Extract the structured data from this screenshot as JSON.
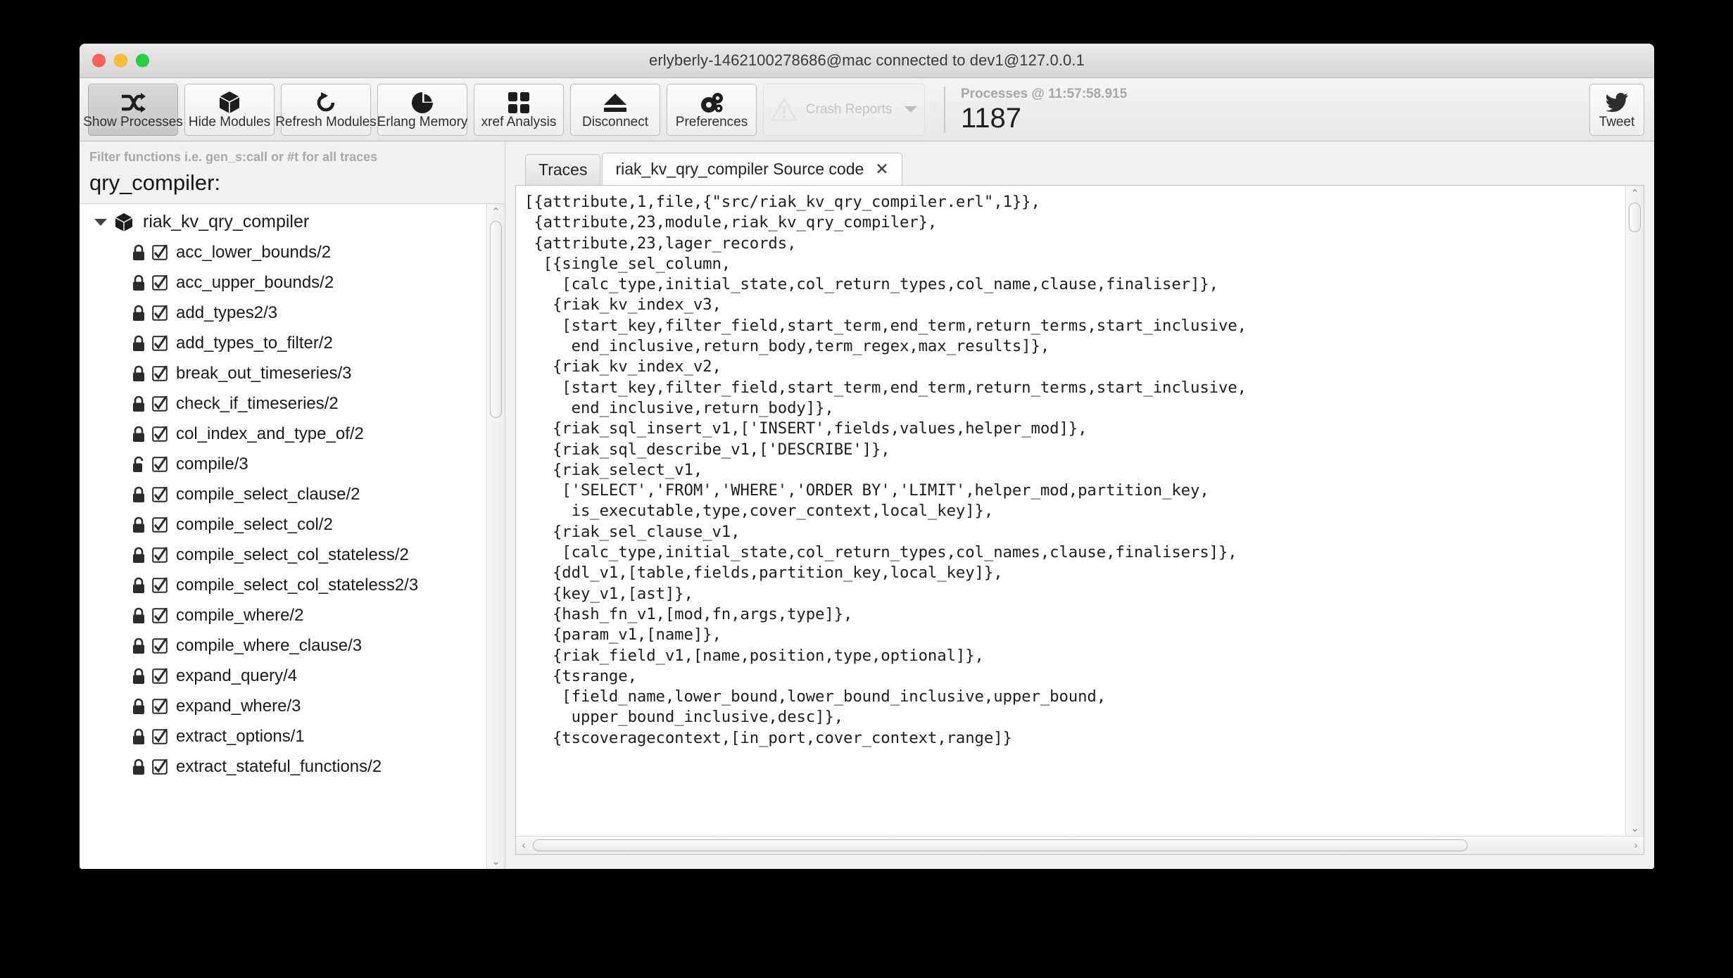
{
  "window": {
    "title": "erlyberly-1462100278686@mac connected to dev1@127.0.0.1",
    "traffic": {
      "close": "close-button",
      "minimize": "minimize-button",
      "zoom": "zoom-button"
    }
  },
  "toolbar": {
    "buttons": [
      {
        "label": "Show Processes",
        "icon": "shuffle-icon",
        "state": "active"
      },
      {
        "label": "Hide Modules",
        "icon": "cube-icon",
        "state": "normal"
      },
      {
        "label": "Refresh Modules",
        "icon": "refresh-icon",
        "state": "normal"
      },
      {
        "label": "Erlang Memory",
        "icon": "pie-chart-icon",
        "state": "normal"
      },
      {
        "label": "xref Analysis",
        "icon": "grid-icon",
        "state": "normal"
      },
      {
        "label": "Disconnect",
        "icon": "eject-icon",
        "state": "normal"
      },
      {
        "label": "Preferences",
        "icon": "gears-icon",
        "state": "normal"
      },
      {
        "label": "Crash Reports",
        "icon": "warning-icon",
        "state": "disabled"
      }
    ],
    "processes_label": "Processes @ 11:57:58.915",
    "processes_count": "1187",
    "tweet_label": "Tweet",
    "tweet_icon": "twitter-bird-icon"
  },
  "sidebar": {
    "filter_placeholder": "Filter functions i.e. gen_s:call or #t for all traces",
    "filter_value": "qry_compiler:",
    "tree_root": {
      "label": "riak_kv_qry_compiler",
      "icon": "cube-icon",
      "expanded": true
    },
    "functions": [
      {
        "label": "acc_lower_bounds/2",
        "locked": true,
        "checked": true
      },
      {
        "label": "acc_upper_bounds/2",
        "locked": true,
        "checked": true
      },
      {
        "label": "add_types2/3",
        "locked": true,
        "checked": true
      },
      {
        "label": "add_types_to_filter/2",
        "locked": true,
        "checked": true
      },
      {
        "label": "break_out_timeseries/3",
        "locked": true,
        "checked": true
      },
      {
        "label": "check_if_timeseries/2",
        "locked": true,
        "checked": true
      },
      {
        "label": "col_index_and_type_of/2",
        "locked": true,
        "checked": true
      },
      {
        "label": "compile/3",
        "locked": false,
        "checked": true
      },
      {
        "label": "compile_select_clause/2",
        "locked": true,
        "checked": true
      },
      {
        "label": "compile_select_col/2",
        "locked": true,
        "checked": true
      },
      {
        "label": "compile_select_col_stateless/2",
        "locked": true,
        "checked": true
      },
      {
        "label": "compile_select_col_stateless2/3",
        "locked": true,
        "checked": true
      },
      {
        "label": "compile_where/2",
        "locked": true,
        "checked": true
      },
      {
        "label": "compile_where_clause/3",
        "locked": true,
        "checked": true
      },
      {
        "label": "expand_query/4",
        "locked": true,
        "checked": true
      },
      {
        "label": "expand_where/3",
        "locked": true,
        "checked": true
      },
      {
        "label": "extract_options/1",
        "locked": true,
        "checked": true
      },
      {
        "label": "extract_stateful_functions/2",
        "locked": true,
        "checked": true
      }
    ]
  },
  "main": {
    "tabs": [
      {
        "label": "Traces",
        "selected": false,
        "closable": false
      },
      {
        "label": "riak_kv_qry_compiler Source code",
        "selected": true,
        "closable": true,
        "close_label": "✕"
      }
    ],
    "source_code": "[{attribute,1,file,{\"src/riak_kv_qry_compiler.erl\",1}},\n {attribute,23,module,riak_kv_qry_compiler},\n {attribute,23,lager_records,\n  [{single_sel_column,\n    [calc_type,initial_state,col_return_types,col_name,clause,finaliser]},\n   {riak_kv_index_v3,\n    [start_key,filter_field,start_term,end_term,return_terms,start_inclusive,\n     end_inclusive,return_body,term_regex,max_results]},\n   {riak_kv_index_v2,\n    [start_key,filter_field,start_term,end_term,return_terms,start_inclusive,\n     end_inclusive,return_body]},\n   {riak_sql_insert_v1,['INSERT',fields,values,helper_mod]},\n   {riak_sql_describe_v1,['DESCRIBE']},\n   {riak_select_v1,\n    ['SELECT','FROM','WHERE','ORDER BY','LIMIT',helper_mod,partition_key,\n     is_executable,type,cover_context,local_key]},\n   {riak_sel_clause_v1,\n    [calc_type,initial_state,col_return_types,col_names,clause,finalisers]},\n   {ddl_v1,[table,fields,partition_key,local_key]},\n   {key_v1,[ast]},\n   {hash_fn_v1,[mod,fn,args,type]},\n   {param_v1,[name]},\n   {riak_field_v1,[name,position,type,optional]},\n   {tsrange,\n    [field_name,lower_bound,lower_bound_inclusive,upper_bound,\n     upper_bound_inclusive,desc]},\n   {tscoveragecontext,[in_port,cover_context,range]}"
  },
  "scrollbars": {
    "sidebar_vertical": {
      "up": "⌃",
      "down": "⌄"
    },
    "code_vertical": {
      "up": "⌃",
      "down": "⌄"
    },
    "code_horizontal": {
      "left": "‹",
      "right": "›"
    }
  },
  "colors": {
    "window_bg": "#f0f0f0",
    "accent_selected_tab": "#fdfdfd",
    "text_primary": "#1b1b1b",
    "text_muted": "#a9a9a9"
  }
}
